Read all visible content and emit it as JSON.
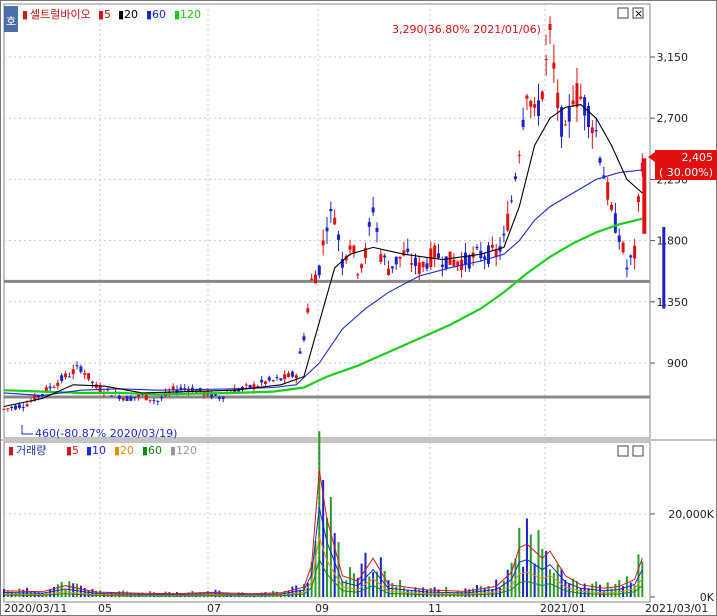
{
  "chart_data": [
    {
      "type": "candlestick",
      "title": "셀트럴바이오",
      "legend": [
        {
          "label": "5",
          "color": "#d01818"
        },
        {
          "label": "20",
          "color": "#000000"
        },
        {
          "label": "60",
          "color": "#1c2bd0"
        },
        {
          "label": "120",
          "color": "#11cc11"
        }
      ],
      "y_ticks": [
        3150,
        2700,
        2250,
        1800,
        1350,
        900
      ],
      "y_tick_labels": [
        "3,150",
        "2,700",
        "2,250",
        "1,800",
        "1,350",
        "900"
      ],
      "ylim": [
        420,
        3450
      ],
      "x_tick_labels": [
        "2020/03/11",
        "05",
        "07",
        "09",
        "11",
        "2021/01",
        "2021/03/01"
      ],
      "current_price": "2,405",
      "current_change": "( 30.00%)",
      "high_annotation": "3,290(36.80% 2021/01/06)",
      "low_annotation": "460(-80.87% 2020/03/19)",
      "horizontal_lines": [
        1500,
        650
      ],
      "price_points": [
        [
          0,
          560
        ],
        [
          6,
          600
        ],
        [
          12,
          720
        ],
        [
          16,
          800
        ],
        [
          20,
          870
        ],
        [
          24,
          720
        ],
        [
          28,
          680
        ],
        [
          32,
          640
        ],
        [
          36,
          660
        ],
        [
          40,
          620
        ],
        [
          44,
          700
        ],
        [
          48,
          720
        ],
        [
          52,
          680
        ],
        [
          56,
          650
        ],
        [
          60,
          700
        ],
        [
          64,
          720
        ],
        [
          68,
          760
        ],
        [
          72,
          780
        ],
        [
          76,
          820
        ],
        [
          78,
          1100
        ],
        [
          80,
          1500
        ],
        [
          82,
          1600
        ],
        [
          84,
          1950
        ],
        [
          86,
          2000
        ],
        [
          88,
          1650
        ],
        [
          90,
          1800
        ],
        [
          92,
          1600
        ],
        [
          94,
          1700
        ],
        [
          96,
          2050
        ],
        [
          98,
          1700
        ],
        [
          100,
          1600
        ],
        [
          104,
          1700
        ],
        [
          108,
          1600
        ],
        [
          112,
          1700
        ],
        [
          116,
          1650
        ],
        [
          120,
          1650
        ],
        [
          124,
          1700
        ],
        [
          128,
          1700
        ],
        [
          130,
          1800
        ],
        [
          132,
          2100
        ],
        [
          134,
          2500
        ],
        [
          136,
          2950
        ],
        [
          138,
          2700
        ],
        [
          140,
          2900
        ],
        [
          142,
          3290
        ],
        [
          144,
          2800
        ],
        [
          146,
          2550
        ],
        [
          148,
          2900
        ],
        [
          150,
          2850
        ],
        [
          152,
          2750
        ],
        [
          154,
          2600
        ],
        [
          156,
          2300
        ],
        [
          158,
          2000
        ],
        [
          160,
          1850
        ],
        [
          162,
          1600
        ],
        [
          164,
          1700
        ],
        [
          166,
          2405
        ]
      ],
      "ma5": [
        [
          0,
          560
        ],
        [
          10,
          650
        ],
        [
          16,
          780
        ],
        [
          22,
          790
        ],
        [
          30,
          680
        ],
        [
          40,
          650
        ],
        [
          50,
          700
        ],
        [
          60,
          690
        ],
        [
          70,
          740
        ],
        [
          76,
          790
        ],
        [
          80,
          1300
        ],
        [
          84,
          1800
        ],
        [
          88,
          1800
        ],
        [
          92,
          1680
        ],
        [
          96,
          1850
        ],
        [
          100,
          1680
        ],
        [
          110,
          1650
        ],
        [
          120,
          1680
        ],
        [
          128,
          1720
        ],
        [
          132,
          2000
        ],
        [
          136,
          2700
        ],
        [
          140,
          2850
        ],
        [
          144,
          2950
        ],
        [
          148,
          2800
        ],
        [
          152,
          2750
        ],
        [
          156,
          2400
        ],
        [
          160,
          1950
        ],
        [
          164,
          1750
        ],
        [
          166,
          1900
        ]
      ],
      "ma20": [
        [
          0,
          580
        ],
        [
          10,
          640
        ],
        [
          18,
          740
        ],
        [
          26,
          730
        ],
        [
          36,
          680
        ],
        [
          48,
          690
        ],
        [
          60,
          700
        ],
        [
          72,
          740
        ],
        [
          78,
          800
        ],
        [
          82,
          1200
        ],
        [
          86,
          1600
        ],
        [
          90,
          1700
        ],
        [
          96,
          1750
        ],
        [
          104,
          1700
        ],
        [
          114,
          1660
        ],
        [
          124,
          1700
        ],
        [
          130,
          1750
        ],
        [
          134,
          2050
        ],
        [
          138,
          2500
        ],
        [
          142,
          2700
        ],
        [
          146,
          2780
        ],
        [
          150,
          2800
        ],
        [
          154,
          2700
        ],
        [
          158,
          2500
        ],
        [
          162,
          2250
        ],
        [
          166,
          2150
        ]
      ],
      "ma60": [
        [
          0,
          680
        ],
        [
          10,
          660
        ],
        [
          20,
          700
        ],
        [
          30,
          710
        ],
        [
          40,
          700
        ],
        [
          50,
          705
        ],
        [
          60,
          710
        ],
        [
          70,
          720
        ],
        [
          76,
          740
        ],
        [
          82,
          900
        ],
        [
          88,
          1150
        ],
        [
          94,
          1300
        ],
        [
          100,
          1420
        ],
        [
          108,
          1540
        ],
        [
          116,
          1600
        ],
        [
          124,
          1650
        ],
        [
          130,
          1700
        ],
        [
          134,
          1800
        ],
        [
          138,
          1950
        ],
        [
          142,
          2050
        ],
        [
          148,
          2150
        ],
        [
          154,
          2250
        ],
        [
          160,
          2300
        ],
        [
          166,
          2320
        ]
      ],
      "ma120": [
        [
          0,
          700
        ],
        [
          10,
          690
        ],
        [
          20,
          680
        ],
        [
          30,
          680
        ],
        [
          40,
          670
        ],
        [
          50,
          675
        ],
        [
          60,
          680
        ],
        [
          70,
          690
        ],
        [
          78,
          720
        ],
        [
          84,
          800
        ],
        [
          92,
          880
        ],
        [
          100,
          980
        ],
        [
          108,
          1080
        ],
        [
          116,
          1180
        ],
        [
          124,
          1300
        ],
        [
          130,
          1420
        ],
        [
          136,
          1560
        ],
        [
          142,
          1680
        ],
        [
          148,
          1780
        ],
        [
          154,
          1860
        ],
        [
          160,
          1920
        ],
        [
          166,
          1960
        ]
      ]
    },
    {
      "type": "bar",
      "title": "거래량",
      "legend": [
        {
          "label": "5",
          "color": "#d01818"
        },
        {
          "label": "10",
          "color": "#1c2bd0"
        },
        {
          "label": "20",
          "color": "#e09000"
        },
        {
          "label": "60",
          "color": "#118811"
        },
        {
          "label": "120",
          "color": "#999999"
        }
      ],
      "y_ticks": [
        20000,
        0
      ],
      "y_tick_labels": [
        "20,000K",
        "0K"
      ],
      "ylim": [
        0,
        38000
      ],
      "volume_points": [
        [
          0,
          1800
        ],
        [
          10,
          1500
        ],
        [
          16,
          3200
        ],
        [
          24,
          1400
        ],
        [
          34,
          1100
        ],
        [
          44,
          900
        ],
        [
          54,
          1300
        ],
        [
          64,
          900
        ],
        [
          72,
          1200
        ],
        [
          78,
          2800
        ],
        [
          80,
          9000
        ],
        [
          82,
          36000
        ],
        [
          84,
          22000
        ],
        [
          86,
          14000
        ],
        [
          88,
          6000
        ],
        [
          92,
          4500
        ],
        [
          96,
          11000
        ],
        [
          100,
          3500
        ],
        [
          110,
          2000
        ],
        [
          120,
          1600
        ],
        [
          128,
          3000
        ],
        [
          132,
          7000
        ],
        [
          134,
          14000
        ],
        [
          136,
          15000
        ],
        [
          140,
          11000
        ],
        [
          142,
          13000
        ],
        [
          146,
          6000
        ],
        [
          150,
          3500
        ],
        [
          156,
          2500
        ],
        [
          160,
          3000
        ],
        [
          164,
          5000
        ],
        [
          166,
          11000
        ]
      ]
    }
  ]
}
